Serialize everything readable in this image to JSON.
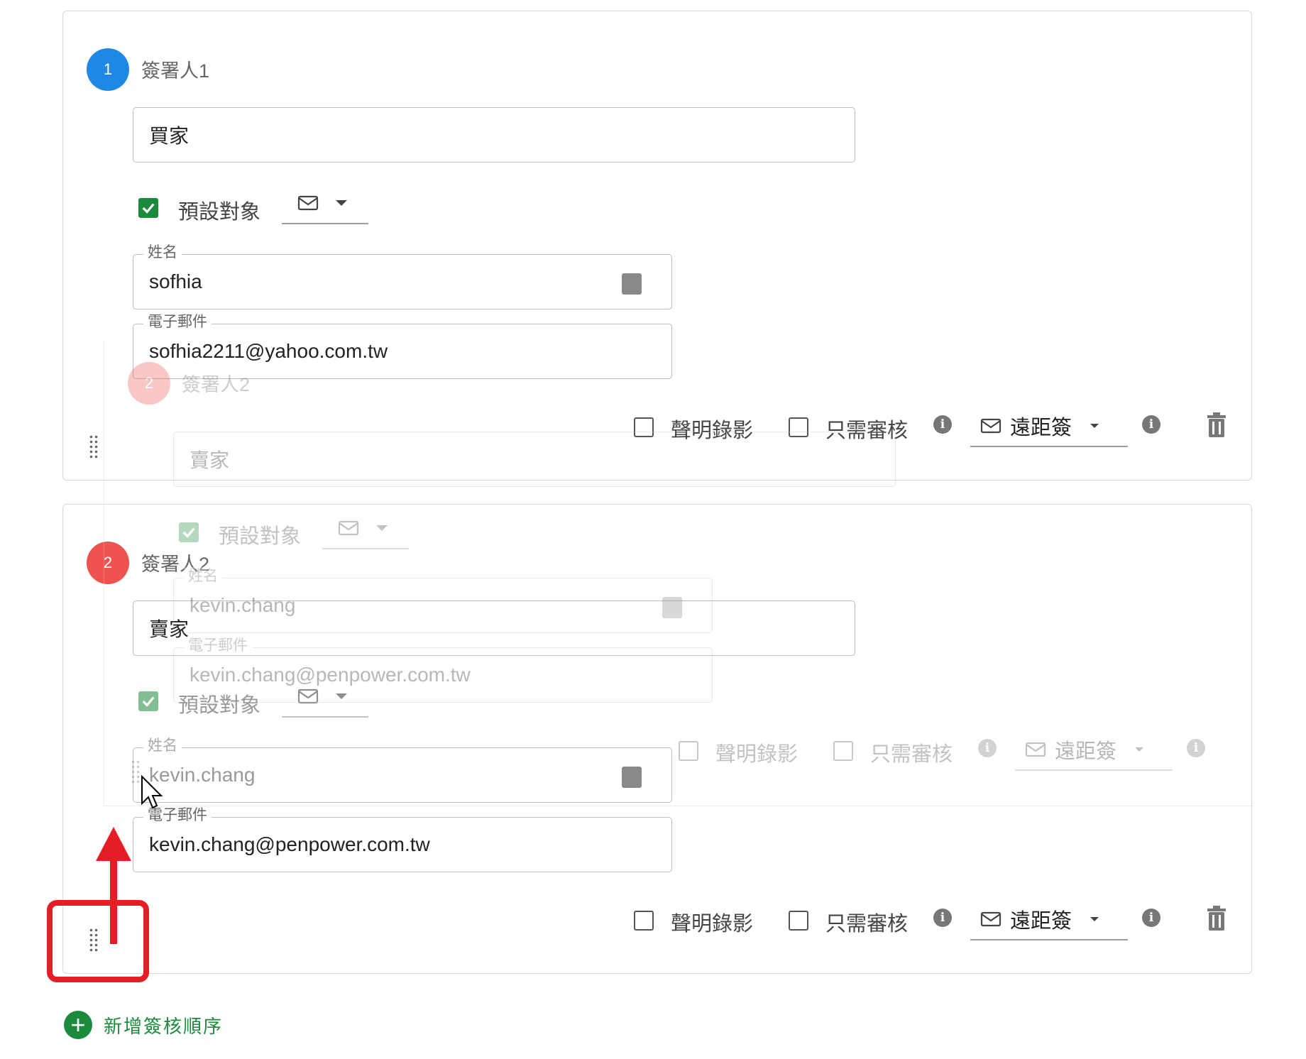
{
  "signers": [
    {
      "number": "1",
      "title": "簽署人1",
      "role": "買家",
      "default_target_label": "預設對象",
      "name_legend": "姓名",
      "name_value": "sofhia",
      "email_legend": "電子郵件",
      "email_value": "sofhia2211@yahoo.com.tw",
      "video_label": "聲明錄影",
      "review_label": "只需審核",
      "method_label": "遠距簽"
    },
    {
      "number": "2",
      "title": "簽署人2",
      "role": "賣家",
      "default_target_label": "預設對象",
      "name_legend": "姓名",
      "name_value": "kevin.chang",
      "email_legend": "電子郵件",
      "email_value": "kevin.chang@penpower.com.tw",
      "video_label": "聲明錄影",
      "review_label": "只需審核",
      "method_label": "遠距簽"
    }
  ],
  "drag_preview": {
    "number": "2",
    "title": "簽署人2",
    "role": "賣家",
    "default_target_label": "預設對象",
    "name_legend": "姓名",
    "name_value": "kevin.chang",
    "email_legend": "電子郵件",
    "email_value": "kevin.chang@penpower.com.tw",
    "video_label": "聲明錄影",
    "review_label": "只需審核",
    "method_label": "遠距簽"
  },
  "add_order_label": "新增簽核順序",
  "colors": {
    "signer1_badge": "#1e88e5",
    "signer2_badge": "#ef5350",
    "accent_green": "#1b8a3c",
    "annotation_red": "#e51e25"
  }
}
